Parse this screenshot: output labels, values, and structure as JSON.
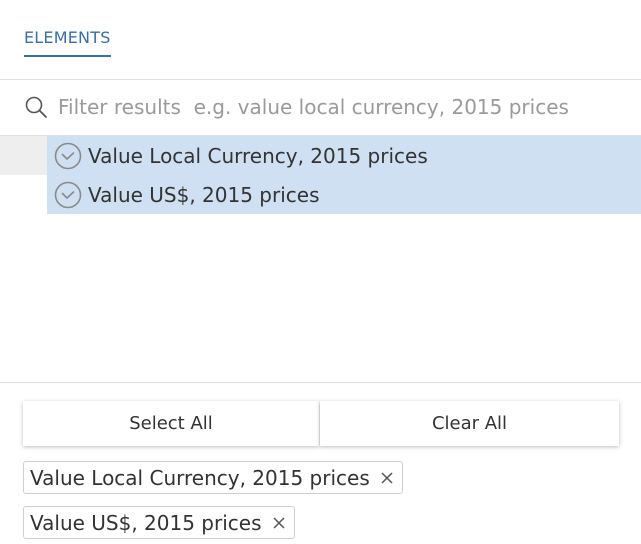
{
  "tabs": [
    {
      "label": "ELEMENTS"
    }
  ],
  "search": {
    "placeholder": "Filter results  e.g. value local currency, 2015 prices",
    "value": ""
  },
  "results": [
    {
      "label": "Value Local Currency, 2015 prices",
      "selected": true
    },
    {
      "label": "Value US$, 2015 prices",
      "selected": true
    }
  ],
  "actions": {
    "select_all": "Select All",
    "clear_all": "Clear All"
  },
  "chips": [
    {
      "label": "Value Local Currency, 2015 prices"
    },
    {
      "label": "Value US$, 2015 prices"
    }
  ],
  "colors": {
    "accent": "#3a6ea5",
    "selected_bg": "#cfe0f3",
    "icon": "#8a8a8a"
  },
  "icons": {
    "search": "search-icon",
    "check": "check-circle-icon",
    "remove": "close-icon"
  }
}
